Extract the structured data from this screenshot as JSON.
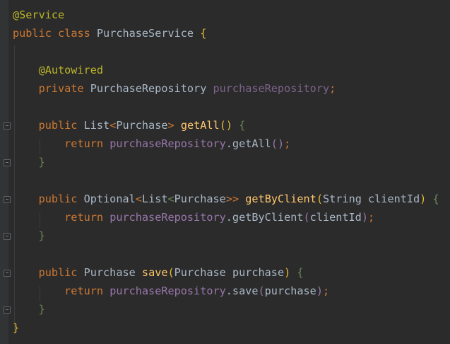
{
  "editor": {
    "language": "Java",
    "theme_colors": {
      "background": "#2b2b2b",
      "default_text": "#a9b7c6",
      "keyword": "#cc7832",
      "annotation": "#bbb529",
      "method_declaration": "#ffc66d",
      "field": "#9876aa",
      "brace_level_1": "#e8ba36",
      "brace_level_2": "#6a8759",
      "brace_level_3": "#9876aa"
    },
    "code": {
      "l1_annotation": "@Service",
      "l2_public": "public",
      "l2_class": "class",
      "l2_name": "PurchaseService",
      "l2_brace": "{",
      "l4_annotation": "@Autowired",
      "l5_private": "private",
      "l5_type": "PurchaseRepository",
      "l5_field": "purchaseRepository",
      "l5_semicolon": ";",
      "m1_public": "public",
      "m1_list": "List",
      "m1_lt": "<",
      "m1_purchase": "Purchase",
      "m1_gt": ">",
      "m1_name": "getAll",
      "m1_parens": "()",
      "m1_brace": "{",
      "m1_return": "return",
      "m1_field": "purchaseRepository",
      "m1_call": ".getAll",
      "m1_call_parens": "()",
      "m1_call_semi": ";",
      "m1_close": "}",
      "m2_public": "public",
      "m2_optional": "Optional",
      "m2_lt1": "<",
      "m2_list": "List",
      "m2_lt2": "<",
      "m2_purchase": "Purchase",
      "m2_gt": ">>",
      "m2_name": "getByClient",
      "m2_open": "(",
      "m2_params": "String clientId",
      "m2_close_paren": ")",
      "m2_brace": "{",
      "m2_return": "return",
      "m2_field": "purchaseRepository",
      "m2_call": ".getByClient",
      "m2_call_open": "(",
      "m2_call_arg": "clientId",
      "m2_call_close": ")",
      "m2_call_semi": ";",
      "m2_close": "}",
      "m3_public": "public",
      "m3_type": "Purchase",
      "m3_name": "save",
      "m3_open": "(",
      "m3_params": "Purchase purchase",
      "m3_close_paren": ")",
      "m3_brace": "{",
      "m3_return": "return",
      "m3_field": "purchaseRepository",
      "m3_call": ".save",
      "m3_call_open": "(",
      "m3_call_arg": "purchase",
      "m3_call_close": ")",
      "m3_call_semi": ";",
      "m3_close": "}",
      "class_close": "}"
    }
  }
}
